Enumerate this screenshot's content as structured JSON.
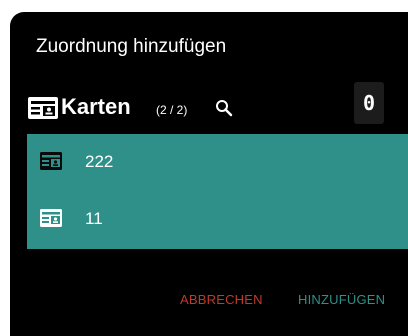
{
  "dialog": {
    "title": "Zuordnung hinzufügen",
    "section_label": "Karten",
    "count": "(2 / 2)",
    "badge_value": "0",
    "items": [
      {
        "label": "222",
        "icon": "id-card-icon"
      },
      {
        "label": "11",
        "icon": "id-card-icon"
      }
    ],
    "cancel_label": "ABBRECHEN",
    "add_label": "HINZUFÜGEN"
  },
  "colors": {
    "background": "#000000",
    "list_background": "#2f9089",
    "accent": "#2f9089",
    "cancel": "#c0392b"
  }
}
